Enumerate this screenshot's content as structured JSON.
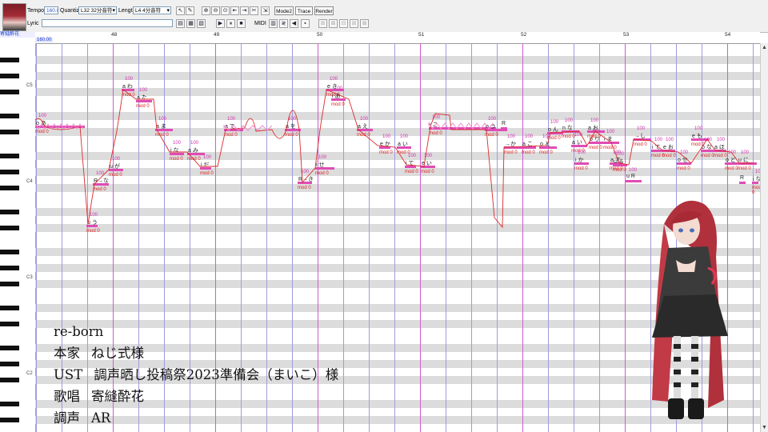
{
  "toolbar": {
    "tempo_label": "Tempo",
    "tempo_value": "160.0",
    "quantize_label": "Quantize",
    "quantize_value": "L32 32分音符",
    "length_label": "Length",
    "length_value": "L4 4分音符",
    "lyric_label": "Lyric",
    "lyric_value": "",
    "midi_label": "MIDI",
    "mode2_label": "Mode2",
    "trace_label": "Trace",
    "render_label": "Render"
  },
  "track_name": "寄縫酔花",
  "tempo_marker": "160.00",
  "ruler": {
    "measures": [
      "48",
      "49",
      "50",
      "51",
      "52",
      "53",
      "54"
    ]
  },
  "piano": {
    "octaves": [
      "C5",
      "C4",
      "C3",
      "C2"
    ]
  },
  "notes": [
    {
      "lyric": "o あ",
      "vel": "100",
      "mod": "mod 0"
    },
    {
      "lyric": "u う",
      "vel": "100",
      "mod": "mod 0"
    },
    {
      "lyric": "R→な",
      "vel": "100",
      "mod": "mod 0"
    },
    {
      "lyric": "u が",
      "vel": "100",
      "mod": "mod 0"
    },
    {
      "lyric": "a わ",
      "vel": "100",
      "mod": "mod 0"
    },
    {
      "lyric": "a た",
      "vel": "100",
      "mod": "mod 0"
    },
    {
      "lyric": "a ま",
      "vel": "100",
      "mod": "mod 0"
    },
    {
      "lyric": "i な",
      "vel": "100",
      "mod": "mod 0"
    },
    {
      "lyric": "a み",
      "vel": "100",
      "mod": "mod 0"
    },
    {
      "lyric": "i だ",
      "vel": "100",
      "mod": "mod 0"
    },
    {
      "lyric": "a て",
      "vel": "100",
      "mod": "mod 0"
    },
    {
      "lyric": "a を",
      "vel": "100",
      "mod": "mod 0"
    },
    {
      "lyric": "R→き",
      "vel": "100",
      "mod": "mod 0"
    },
    {
      "lyric": "i せ",
      "vel": "100",
      "mod": "mod 0"
    },
    {
      "lyric": "e き",
      "vel": "100",
      "mod": "mod 0"
    },
    {
      "lyric": "i あ",
      "vel": "100",
      "mod": "mod 0"
    },
    {
      "lyric": "a え",
      "vel": "100",
      "mod": "mod 0"
    },
    {
      "lyric": "e か",
      "vel": "100",
      "mod": "mod 0"
    },
    {
      "lyric": "a い",
      "vel": "100",
      "mod": "mod 0"
    },
    {
      "lyric": "i て",
      "vel": "100",
      "mod": "mod 0"
    },
    {
      "lyric": "e い",
      "vel": "100",
      "mod": "mod 0"
    },
    {
      "lyric": "i こ",
      "vel": "100",
      "mod": "mod 0"
    },
    {
      "lyric": "o う",
      "vel": "100",
      "mod": "mod 0"
    },
    {
      "lyric": "R",
      "vel": "",
      "mod": ""
    },
    {
      "lyric": "→か",
      "vel": "100",
      "mod": "mod 0"
    },
    {
      "lyric": "a こ",
      "vel": "100",
      "mod": "mod 0"
    },
    {
      "lyric": "o と",
      "vel": "100",
      "mod": "mod 0"
    },
    {
      "lyric": "o ん",
      "vel": "100",
      "mod": "mod 0"
    },
    {
      "lyric": "n な",
      "vel": "100",
      "mod": "mod 0"
    },
    {
      "lyric": "a い",
      "vel": "100",
      "mod": "mod 0"
    },
    {
      "lyric": "i か",
      "vel": "100",
      "mod": "mod 0"
    },
    {
      "lyric": "a お",
      "vel": "100",
      "mod": "mod 0"
    },
    {
      "lyric": "o り",
      "vel": "100",
      "mod": "mod 0"
    },
    {
      "lyric": "i ま",
      "vel": "100",
      "mod": "mod 0"
    },
    {
      "lyric": "a す",
      "vel": "100",
      "mod": "mod 0"
    },
    {
      "lyric": "u る",
      "vel": "100",
      "mod": "mod 0"
    },
    {
      "lyric": "u R",
      "vel": "100",
      "mod": ""
    },
    {
      "lyric": "→し",
      "vel": "100",
      "mod": "mod 0"
    },
    {
      "lyric": "i て",
      "vel": "100",
      "mod": "mod 0"
    },
    {
      "lyric": "e お",
      "vel": "100",
      "mod": "mod 0"
    },
    {
      "lyric": "o せ",
      "vel": "100",
      "mod": "mod 0"
    },
    {
      "lyric": "e も",
      "vel": "100",
      "mod": "mod 0"
    },
    {
      "lyric": "o な",
      "vel": "100",
      "mod": "mod 0"
    },
    {
      "lyric": "a ほ",
      "vel": "100",
      "mod": "mod 0"
    },
    {
      "lyric": "o ど",
      "vel": "100",
      "mod": "mod 0"
    },
    {
      "lyric": "u に",
      "vel": "100",
      "mod": "mod 0"
    },
    {
      "lyric": "i な",
      "vel": "100",
      "mod": "mod 0"
    },
    {
      "lyric": "R",
      "vel": "",
      "mod": ""
    }
  ],
  "credits": [
    {
      "label": "re-born",
      "value": ""
    },
    {
      "label": "本家",
      "value": "ねじ式様"
    },
    {
      "label": "UST",
      "value": "調声晒し投稿祭2023準備会（まいこ）様"
    },
    {
      "label": "歌唱",
      "value": "寄縫酔花"
    },
    {
      "label": "調声",
      "value": "AR"
    }
  ],
  "colors": {
    "note": "#e04bb4",
    "pitch_curve": "#dd2a2a",
    "vibrato": "#f08ad0",
    "lane_dark": "#dcdcdc",
    "measure_line": "#cf5ccf",
    "beat_line": "#9c9cdc"
  }
}
